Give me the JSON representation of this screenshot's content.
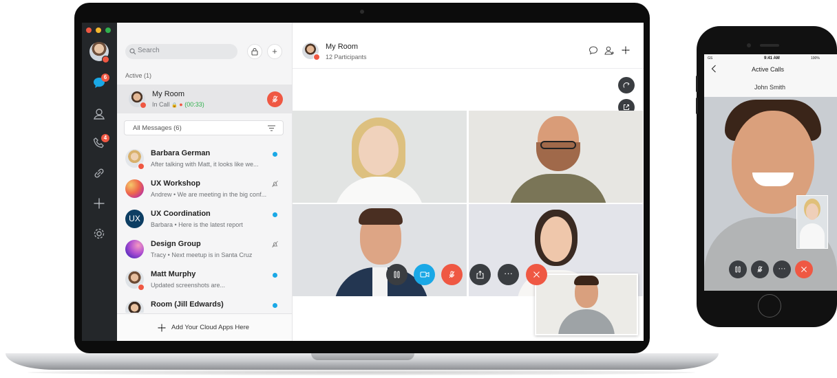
{
  "colors": {
    "red": "#ef5843",
    "blue": "#1aa8e6",
    "green": "#31b14e",
    "dark_rail": "#24272a"
  },
  "sidebar": {
    "search_placeholder": "Search",
    "active_header": "Active (1)",
    "active_call": {
      "name": "My Room",
      "status_prefix": "In Call",
      "timer": "(00:33)"
    },
    "filter_label": "All Messages (6)",
    "badges": {
      "messages": "6",
      "calls": "4"
    },
    "conversations": [
      {
        "name": "Barbara German",
        "preview": "After talking with Matt, it looks like we...",
        "indicator": "unread"
      },
      {
        "name": "UX Workshop",
        "preview": "Andrew • We are meeting in the big conf...",
        "indicator": "muted"
      },
      {
        "name": "UX Coordination",
        "preview": "Barbara • Here is the latest report",
        "indicator": "unread",
        "avatar_text": "UX"
      },
      {
        "name": "Design Group",
        "preview": "Tracy • Next meetup is in Santa Cruz",
        "indicator": "muted"
      },
      {
        "name": "Matt Murphy",
        "preview": "Updated screenshots are...",
        "indicator": "unread"
      },
      {
        "name": "Room (Jill Edwards)",
        "preview": "",
        "indicator": "unread"
      }
    ],
    "add_apps_label": "Add Your Cloud Apps Here"
  },
  "header": {
    "title": "My Room",
    "subtitle": "12 Participants"
  },
  "phone": {
    "carrier": "GS",
    "time": "9:41 AM",
    "battery": "100%",
    "title": "Active Calls",
    "caller": "John Smith"
  }
}
